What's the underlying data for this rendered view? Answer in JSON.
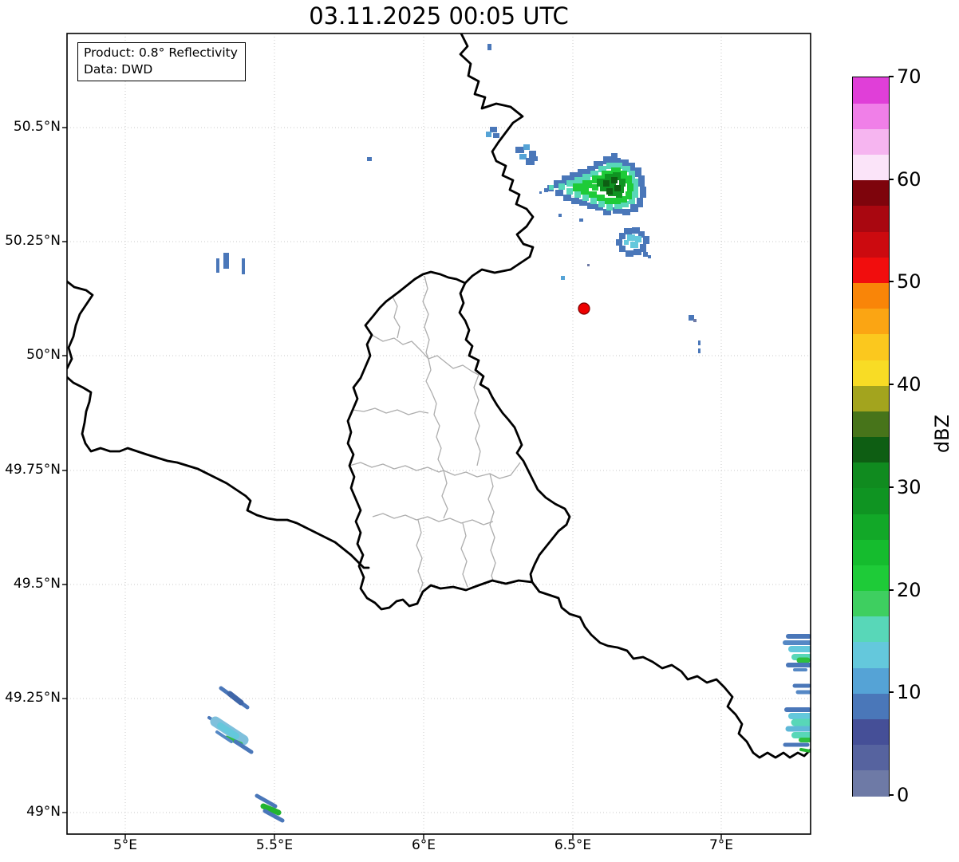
{
  "title": "03.11.2025 00:05 UTC",
  "info_box": {
    "line1": "Product: 0.8° Reflectivity",
    "line2": "Data: DWD"
  },
  "axes": {
    "lat_ticks": [
      "50.5°N",
      "50.25°N",
      "50°N",
      "49.75°N",
      "49.5°N",
      "49.25°N",
      "49°N"
    ],
    "lon_ticks": [
      "5°E",
      "5.5°E",
      "6°E",
      "6.5°E",
      "7°E"
    ]
  },
  "colorbar": {
    "label": "dBZ",
    "tick_values": [
      0,
      10,
      20,
      30,
      40,
      50,
      60,
      70
    ],
    "segments": [
      {
        "from": 0,
        "to": 2.5,
        "color": "#6e7aa6"
      },
      {
        "from": 2.5,
        "to": 5,
        "color": "#56639f"
      },
      {
        "from": 5,
        "to": 7.5,
        "color": "#454f97"
      },
      {
        "from": 7.5,
        "to": 10,
        "color": "#4a77b9"
      },
      {
        "from": 10,
        "to": 12.5,
        "color": "#55a3d6"
      },
      {
        "from": 12.5,
        "to": 15,
        "color": "#64c8dc"
      },
      {
        "from": 15,
        "to": 17.5,
        "color": "#58d7b8"
      },
      {
        "from": 17.5,
        "to": 20,
        "color": "#3ecf60"
      },
      {
        "from": 20,
        "to": 22.5,
        "color": "#1ecb38"
      },
      {
        "from": 22.5,
        "to": 25,
        "color": "#15bc2e"
      },
      {
        "from": 25,
        "to": 27.5,
        "color": "#12a828"
      },
      {
        "from": 27.5,
        "to": 30,
        "color": "#0f9422"
      },
      {
        "from": 30,
        "to": 32.5,
        "color": "#108b1f"
      },
      {
        "from": 32.5,
        "to": 35,
        "color": "#0e5e13"
      },
      {
        "from": 35,
        "to": 37.5,
        "color": "#47741a"
      },
      {
        "from": 37.5,
        "to": 40,
        "color": "#a3a41e"
      },
      {
        "from": 40,
        "to": 42.5,
        "color": "#f8dc25"
      },
      {
        "from": 42.5,
        "to": 45,
        "color": "#fbc81e"
      },
      {
        "from": 45,
        "to": 47.5,
        "color": "#fba513"
      },
      {
        "from": 47.5,
        "to": 50,
        "color": "#f98508"
      },
      {
        "from": 50,
        "to": 52.5,
        "color": "#f10d0d"
      },
      {
        "from": 52.5,
        "to": 55,
        "color": "#cc0a0f"
      },
      {
        "from": 55,
        "to": 57.5,
        "color": "#a90710"
      },
      {
        "from": 57.5,
        "to": 60,
        "color": "#7e040c"
      },
      {
        "from": 60,
        "to": 62.5,
        "color": "#fbe4f9"
      },
      {
        "from": 62.5,
        "to": 65,
        "color": "#f6b5f0"
      },
      {
        "from": 65,
        "to": 67.5,
        "color": "#f07fe8"
      },
      {
        "from": 67.5,
        "to": 70,
        "color": "#e03fd8"
      }
    ]
  },
  "map": {
    "marker": {
      "description": "red filled circle marker",
      "color": "#ee0000",
      "approx_position": "50.11°N, 6.55°E"
    },
    "borders": {
      "country_border_color": "#000000",
      "district_border_color": "#adadad",
      "grid_color": "#c9c9c9"
    },
    "radar_echoes": [
      {
        "area": "near Belgian-German border, ~50.38°N 6.55°E",
        "intensity_dbz": "5-35",
        "shape": "large blob with green core and western tail"
      },
      {
        "area": "~50.28°N 6.62°E",
        "intensity_dbz": "5-17",
        "shape": "small blob"
      },
      {
        "area": "along border ~50.33-50.42°N 6.2°E",
        "intensity_dbz": "5-10",
        "shape": "small blue patches"
      },
      {
        "area": "~50.2°N 5.32°E",
        "intensity_dbz": "5-10",
        "shape": "three small vertical dashes"
      },
      {
        "area": "southwest ~49.22-49.26°N 5.33°E",
        "intensity_dbz": "5-25",
        "shape": "diagonal streaks with teal patch and green dash"
      },
      {
        "area": "south ~49.02°N 5.46°E",
        "intensity_dbz": "5-25",
        "shape": "short diagonal streaks with green core"
      },
      {
        "area": "southeast map edge ~49.2-49.35°N 7.28°E",
        "intensity_dbz": "5-25",
        "shape": "clipped streaky patches at right edge"
      }
    ]
  }
}
